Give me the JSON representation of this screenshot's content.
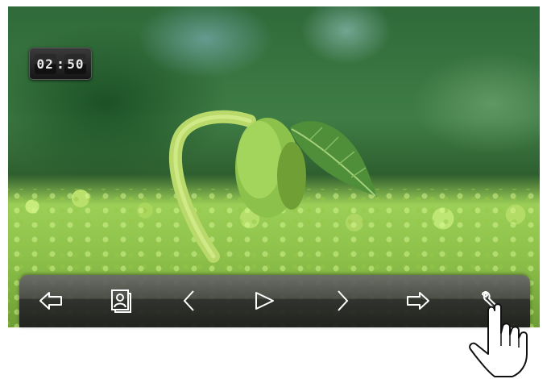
{
  "clock": {
    "hours": "02",
    "minutes": "50",
    "colon": ":"
  },
  "toolbar": {
    "buttons": [
      {
        "name": "back-button",
        "icon": "back-arrow-icon"
      },
      {
        "name": "contact-card-button",
        "icon": "contact-card-icon"
      },
      {
        "name": "previous-button",
        "icon": "chevron-left-icon"
      },
      {
        "name": "play-button",
        "icon": "play-triangle-icon"
      },
      {
        "name": "next-button",
        "icon": "chevron-right-icon"
      },
      {
        "name": "forward-button",
        "icon": "forward-arrow-icon"
      },
      {
        "name": "settings-button",
        "icon": "wrench-icon"
      }
    ]
  },
  "colors": {
    "toolbar_icon": "#ffffff",
    "clock_digit": "#eaeaea",
    "leaf_green": "#6aa84f"
  }
}
